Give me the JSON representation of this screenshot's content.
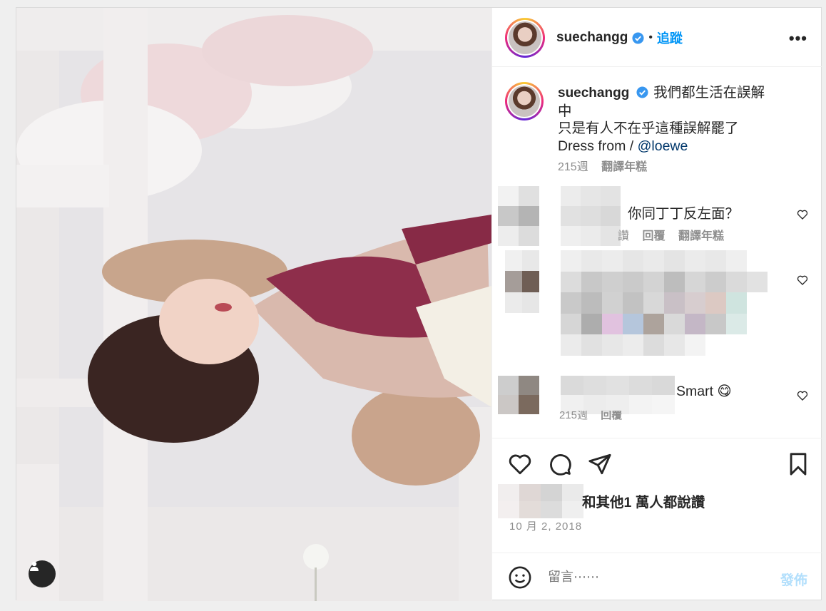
{
  "post": {
    "username": "suechangg",
    "follow_label": "追蹤",
    "more_label": "•••",
    "caption_line1": "我們都生活在誤解",
    "caption_line2": "中",
    "caption_line3": "只是有人不在乎這種誤解罷了",
    "caption_line4_prefix": "Dress from / ",
    "caption_mention": "@loewe",
    "caption_time": "215週",
    "caption_translate": "翻譯年糕"
  },
  "comments": [
    {
      "text": "你同丁丁反左面？",
      "actions": [
        "讚",
        "回覆",
        "翻譯年糕"
      ]
    },
    {
      "text": ""
    },
    {
      "text": "Smart 😋",
      "time": "215週",
      "reply": "回覆"
    }
  ],
  "likes_text": "和其他1 萬人都說讚",
  "date_text": "10 月 2, 2018",
  "comment_input": {
    "placeholder": "留言⋯⋯",
    "post_label": "發佈"
  },
  "colors": {
    "accent": "#0095f6",
    "post_disabled": "#b2dffc",
    "mention": "#00376b",
    "meta": "#8e8e8e"
  }
}
